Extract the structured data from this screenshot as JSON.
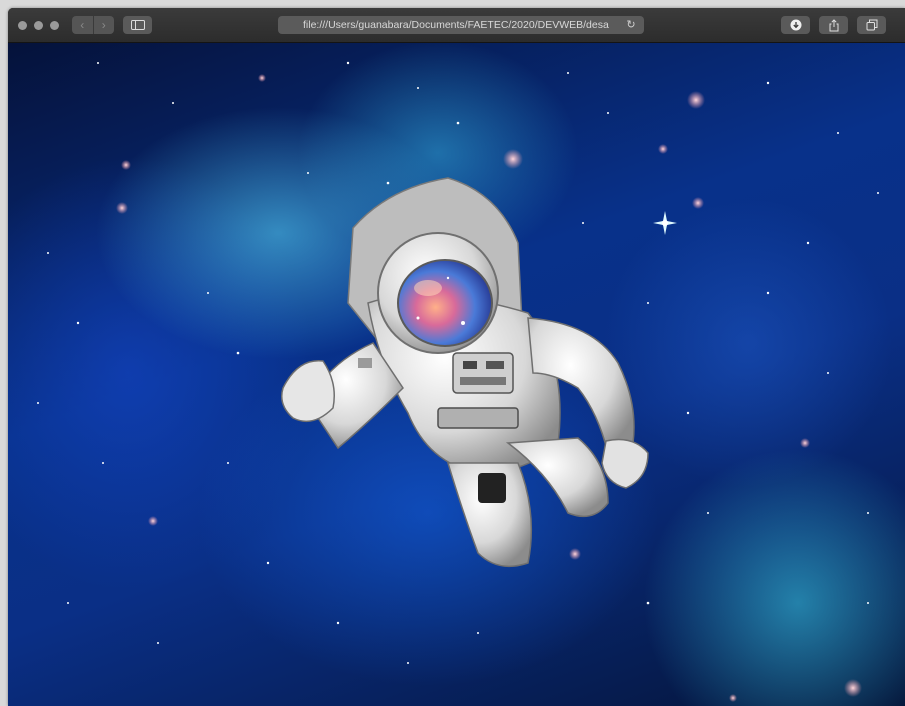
{
  "browser": {
    "address_bar": {
      "url": "file:///Users/guanabara/Documents/FAETEC/2020/DEVWEB/desa"
    },
    "icons": {
      "back": "chevron-left-icon",
      "forward": "chevron-right-icon",
      "sidebar": "sidebar-icon",
      "reload": "reload-icon",
      "download": "download-icon",
      "share": "share-icon",
      "tabs": "tabs-overview-icon"
    },
    "colors": {
      "toolbar": "#333333",
      "address_bar": "#5b5b5b",
      "traffic_light": "#9a9a9a"
    }
  },
  "page": {
    "content_image": "astronaut-in-space",
    "colors": {
      "space_deep": "#05123a",
      "space_blue": "#0a3fa8",
      "nebula_cyan": "#5adcff",
      "suit": "#e4e4e4"
    }
  }
}
